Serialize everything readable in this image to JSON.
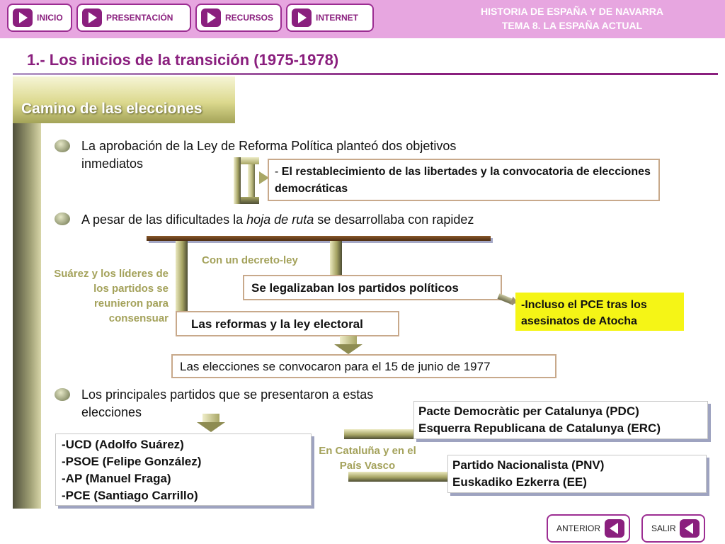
{
  "nav": {
    "inicio": "INICIO",
    "presentacion": "PRESENTACIÓN",
    "recursos": "RECURSOS",
    "internet": "INTERNET"
  },
  "header": {
    "line1": "HISTORIA DE ESPAÑA Y DE NAVARRA",
    "line2": "TEMA 8. LA ESPAÑA ACTUAL"
  },
  "page_title": "1.- Los inicios de la transición (1975-1978)",
  "section_tab": "Camino de las elecciones",
  "block1": {
    "text": "La aprobación de la Ley de Reforma Política planteó dos objetivos inmediatos",
    "box_prefix": "- ",
    "box_text": "El restablecimiento de las libertades y la convocatoria de elecciones democráticas"
  },
  "block2": {
    "text_before": "A pesar de las dificultades la ",
    "text_italic": "hoja de ruta",
    "text_after": " se desarrollaba con rapidez",
    "side_text": "Suárez y los líderes de los partidos se reunieron para consensuar",
    "decreto": "Con un decreto-ley",
    "partidos_box": "Se legalizaban los partidos políticos",
    "pce_note": "-Incluso el PCE tras los asesinatos de Atocha",
    "reformas_box": "Las reformas y la ley electoral",
    "elecciones_box": "Las elecciones se convocaron para el 15 de junio de 1977"
  },
  "block3": {
    "text": "Los principales partidos que se presentaron a estas elecciones",
    "parties": [
      "-UCD (Adolfo Suárez)",
      "-PSOE (Felipe González)",
      "-AP (Manuel Fraga)",
      "-PCE (Santiago Carrillo)"
    ],
    "region_label": "En Cataluña y en el País Vasco",
    "catalunya": [
      "Pacte Democràtic per Catalunya (PDC)",
      "Esquerra Republicana de Catalunya (ERC)"
    ],
    "euskadi": [
      "Partido Nacionalista (PNV)",
      "Euskadiko Ezkerra (EE)"
    ]
  },
  "bottom": {
    "anterior": "ANTERIOR",
    "salir": "SALIR"
  }
}
